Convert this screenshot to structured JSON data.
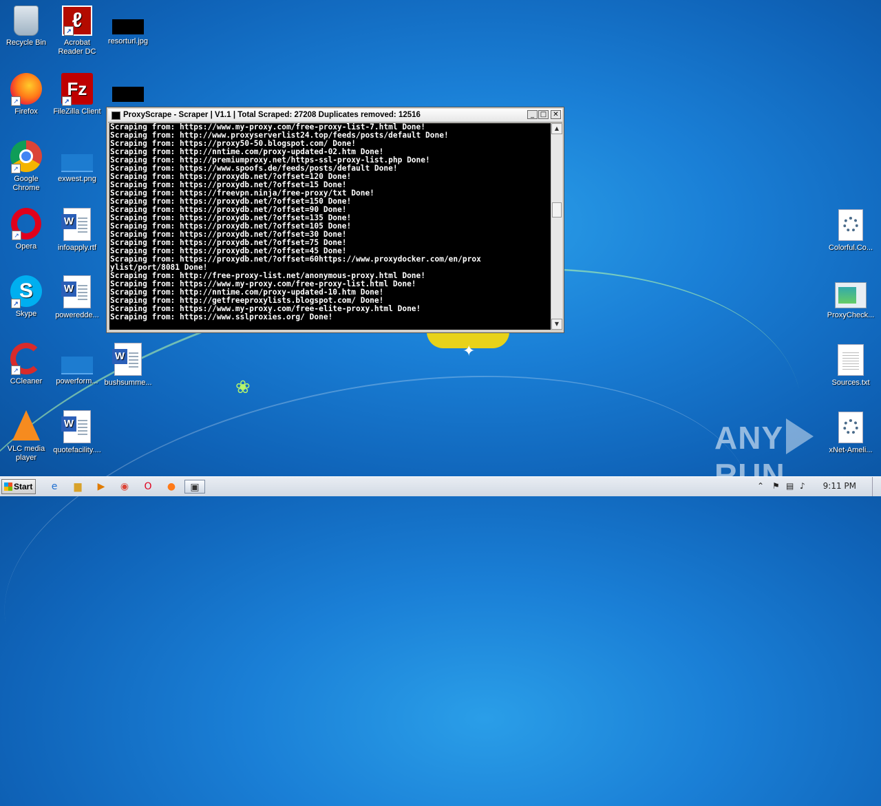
{
  "desktop": {
    "icons_left": [
      {
        "label": "Recycle Bin",
        "icon": "recycle-bin-icon"
      },
      {
        "label": "Acrobat Reader DC",
        "icon": "acrobat-icon"
      },
      {
        "label": "resorturl.jpg",
        "icon": "image-file-icon"
      },
      {
        "label": "Firefox",
        "icon": "firefox-icon"
      },
      {
        "label": "FileZilla Client",
        "icon": "filezilla-icon"
      },
      {
        "label": "",
        "icon": "image-file-icon"
      },
      {
        "label": "Google Chrome",
        "icon": "chrome-icon"
      },
      {
        "label": "exwest.png",
        "icon": "image-file-icon"
      },
      {
        "label": "Opera",
        "icon": "opera-icon"
      },
      {
        "label": "infoapply.rtf",
        "icon": "word-document-icon"
      },
      {
        "label": "Skype",
        "icon": "skype-icon"
      },
      {
        "label": "powereddе...",
        "icon": "word-document-icon"
      },
      {
        "label": "CCleaner",
        "icon": "ccleaner-icon"
      },
      {
        "label": "powerform...",
        "icon": "image-file-icon"
      },
      {
        "label": "bushsumme...",
        "icon": "word-document-icon"
      },
      {
        "label": "VLC media player",
        "icon": "vlc-icon"
      },
      {
        "label": "quotefacility....",
        "icon": "word-document-icon"
      }
    ],
    "icons_right": [
      {
        "label": "Colorful.Co...",
        "icon": "settings-file-icon"
      },
      {
        "label": "ProxyCheck...",
        "icon": "application-icon"
      },
      {
        "label": "Sources.txt",
        "icon": "text-file-icon"
      },
      {
        "label": "xNet-Ameli...",
        "icon": "settings-file-icon"
      }
    ]
  },
  "window": {
    "title": "ProxyScrape - Scraper | V1.1 | Total Scraped: 27208 Duplicates removed: 12516",
    "minimize": "_",
    "maximize": "□",
    "close": "✕",
    "lines": [
      "Scraping from: https://www.my-proxy.com/free-proxy-list-7.html Done!",
      "Scraping from: http://www.proxyserverlist24.top/feeds/posts/default Done!",
      "Scraping from: https://proxy50-50.blogspot.com/ Done!",
      "Scraping from: http://nntime.com/proxy-updated-02.htm Done!",
      "Scraping from: http://premiumproxy.net/https-ssl-proxy-list.php Done!",
      "Scraping from: https://www.spoofs.de/feeds/posts/default Done!",
      "Scraping from: https://proxydb.net/?offset=120 Done!",
      "Scraping from: https://proxydb.net/?offset=15 Done!",
      "Scraping from: https://freevpn.ninja/free-proxy/txt Done!",
      "Scraping from: https://proxydb.net/?offset=150 Done!",
      "Scraping from: https://proxydb.net/?offset=90 Done!",
      "Scraping from: https://proxydb.net/?offset=135 Done!",
      "Scraping from: https://proxydb.net/?offset=105 Done!",
      "Scraping from: https://proxydb.net/?offset=30 Done!",
      "Scraping from: https://proxydb.net/?offset=75 Done!",
      "Scraping from: https://proxydb.net/?offset=45 Done!",
      "Scraping from: https://proxydb.net/?offset=60https://www.proxydocker.com/en/prox",
      "ylist/port/8081 Done!",
      "Scraping from: http://free-proxy-list.net/anonymous-proxy.html Done!",
      "Scraping from: https://www.my-proxy.com/free-proxy-list.html Done!",
      "Scraping from: http://nntime.com/proxy-updated-10.htm Done!",
      "Scraping from: http://getfreeproxylists.blogspot.com/ Done!",
      "Scraping from: https://www.my-proxy.com/free-elite-proxy.html Done!",
      "Scraping from: https://www.sslproxies.org/ Done!"
    ]
  },
  "taskbar": {
    "start_label": "Start",
    "clock": "9:11 PM",
    "items": [
      "internet-explorer-icon",
      "file-explorer-icon",
      "media-player-icon",
      "chrome-icon",
      "opera-icon",
      "firefox-icon",
      "console-window-icon"
    ]
  },
  "watermark": {
    "left": "ANY",
    "right": "RUN"
  }
}
